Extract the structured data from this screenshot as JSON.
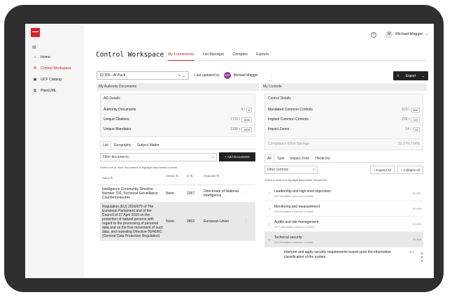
{
  "sidebar": {
    "items": [
      {
        "label": "Home",
        "icon": "home-icon"
      },
      {
        "label": "Control Workspace",
        "icon": "workspace-icon",
        "active": true
      },
      {
        "label": "UCF Catalog",
        "icon": "catalog-icon"
      },
      {
        "label": "PlantUML",
        "icon": "diagram-icon"
      }
    ]
  },
  "header": {
    "help": "?",
    "user_initial": "M",
    "user_name": "Michael Maggio"
  },
  "page": {
    "title": "Control Workspace",
    "tabs": [
      "My Frameworks",
      "List Manager",
      "Compare",
      "Exports"
    ]
  },
  "toolbar": {
    "pack_value": "ID 265 - AI Pack",
    "last_updated_label": "Last updated by",
    "updater_initials": "MM",
    "updater_name": "Michael Maggio",
    "export_label": "Export"
  },
  "authority": {
    "panel_title": "My Authority Documents",
    "details_title": "AD Details",
    "rows": [
      {
        "label": "Authority Documents",
        "value": "4",
        "total": "6"
      },
      {
        "label": "Unique Citations",
        "value": "1732",
        "total": "1846"
      },
      {
        "label": "Unique Mandates",
        "value": "1336",
        "total": "1500"
      }
    ],
    "subtabs": [
      "List",
      "Geography",
      "Subject Matter"
    ],
    "filter_placeholder": "Filter documents",
    "add_button": "+ Add Documents",
    "hint": "Select one or more documents to highlight associated controls",
    "columns": [
      "Name",
      "Version",
      "ID",
      "Originator"
    ],
    "documents": [
      {
        "name": "Intelligence Community Directive Number 702, Technical Surveillance Countermeasures",
        "version": "None",
        "id": "2367",
        "originator": "Directorate of National Intelligence"
      },
      {
        "name": "Regulation (EU) 2016/679 of The European Parliament and of the Council of 27 April 2016 on the protection of natural persons with regard to the processing of personal data and on the free movement of such data, and repealing Directive 95/46/EC (General Data Protection Regulation)",
        "version": "None",
        "id": "2802",
        "originator": "European Union"
      }
    ]
  },
  "controls": {
    "panel_title": "My Controls",
    "details_title": "Control Details",
    "rows": [
      {
        "label": "Mandated Common Controls",
        "value": "623",
        "total": "890"
      },
      {
        "label": "Implied Common Controls",
        "value": "226",
        "total": "210"
      },
      {
        "label": "Impact Zones",
        "value": "14",
        "total": "15"
      }
    ],
    "effort_label": "Compliance Effort Savings",
    "effort_value": "53.37% / 64%",
    "subtabs": [
      "All",
      "Type",
      "Impact Zone",
      "Hierarchy"
    ],
    "filter_placeholder": "Filter controls",
    "expand_all": "+ Expand All",
    "collapse_all": "– Collapse All",
    "hint": "Select a control to highlight associated documents",
    "items": [
      {
        "name": "Leadership and high level objectives",
        "sub": "632 Mandated Common Controls",
        "id": "ID 597"
      },
      {
        "name": "Monitoring and measurement",
        "sub": "616 Mandated Common Controls",
        "id": "ID 636"
      },
      {
        "name": "Audits and risk management",
        "sub": "1177 Mandated Common Controls",
        "id": "ID 672"
      },
      {
        "name": "Technical security",
        "sub": "642 Mandated Common Controls",
        "id": "ID 508"
      }
    ],
    "child": {
      "name": "Interpret and apply security requirements based upon the information classification of the system.",
      "id": "ID 3"
    }
  }
}
